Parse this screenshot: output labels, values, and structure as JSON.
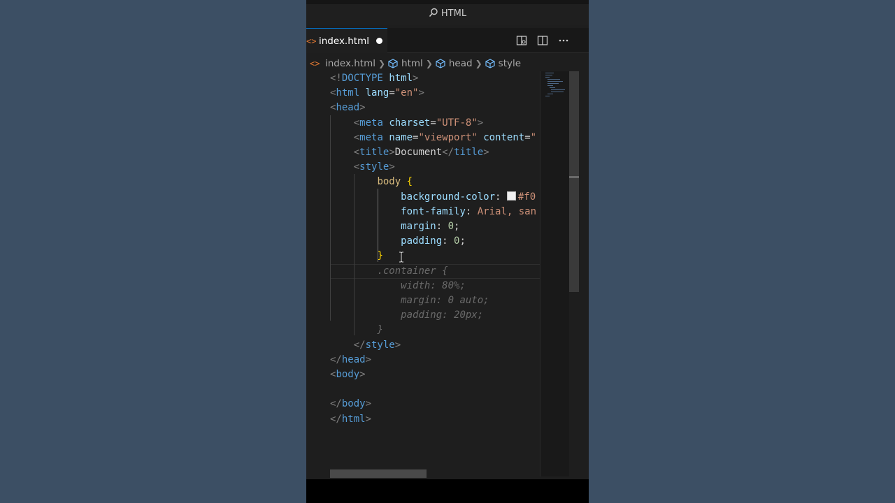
{
  "command_center": {
    "label": "HTML",
    "icon": "search-icon"
  },
  "tab": {
    "icon": "html-file-icon",
    "name": "index.html",
    "modified": true
  },
  "tab_actions": [
    "open-preview-icon",
    "split-editor-icon",
    "more-actions-icon"
  ],
  "breadcrumb": {
    "file": "index.html",
    "items": [
      "html",
      "head",
      "style"
    ]
  },
  "code_lines": [
    [
      {
        "t": "punc",
        "v": "<!"
      },
      {
        "t": "tag",
        "v": "DOCTYPE"
      },
      {
        "t": "text",
        "v": " "
      },
      {
        "t": "attr",
        "v": "html"
      },
      {
        "t": "punc",
        "v": ">"
      }
    ],
    [
      {
        "t": "punc",
        "v": "<"
      },
      {
        "t": "tag",
        "v": "html"
      },
      {
        "t": "text",
        "v": " "
      },
      {
        "t": "attr",
        "v": "lang"
      },
      {
        "t": "text",
        "v": "="
      },
      {
        "t": "str",
        "v": "\"en\""
      },
      {
        "t": "punc",
        "v": ">"
      }
    ],
    [
      {
        "t": "punc",
        "v": "<"
      },
      {
        "t": "tag",
        "v": "head"
      },
      {
        "t": "punc",
        "v": ">"
      }
    ],
    [
      {
        "t": "text",
        "v": "    "
      },
      {
        "t": "punc",
        "v": "<"
      },
      {
        "t": "tag",
        "v": "meta"
      },
      {
        "t": "text",
        "v": " "
      },
      {
        "t": "attr",
        "v": "charset"
      },
      {
        "t": "text",
        "v": "="
      },
      {
        "t": "str",
        "v": "\"UTF-8\""
      },
      {
        "t": "punc",
        "v": ">"
      }
    ],
    [
      {
        "t": "text",
        "v": "    "
      },
      {
        "t": "punc",
        "v": "<"
      },
      {
        "t": "tag",
        "v": "meta"
      },
      {
        "t": "text",
        "v": " "
      },
      {
        "t": "attr",
        "v": "name"
      },
      {
        "t": "text",
        "v": "="
      },
      {
        "t": "str",
        "v": "\"viewport\""
      },
      {
        "t": "text",
        "v": " "
      },
      {
        "t": "attr",
        "v": "content"
      },
      {
        "t": "text",
        "v": "="
      },
      {
        "t": "str",
        "v": "\""
      }
    ],
    [
      {
        "t": "text",
        "v": "    "
      },
      {
        "t": "punc",
        "v": "<"
      },
      {
        "t": "tag",
        "v": "title"
      },
      {
        "t": "punc",
        "v": ">"
      },
      {
        "t": "text",
        "v": "Document"
      },
      {
        "t": "punc",
        "v": "</"
      },
      {
        "t": "tag",
        "v": "title"
      },
      {
        "t": "punc",
        "v": ">"
      }
    ],
    [
      {
        "t": "text",
        "v": "    "
      },
      {
        "t": "punc",
        "v": "<"
      },
      {
        "t": "tag",
        "v": "style"
      },
      {
        "t": "punc",
        "v": ">"
      }
    ],
    [
      {
        "t": "text",
        "v": "        "
      },
      {
        "t": "sel",
        "v": "body"
      },
      {
        "t": "text",
        "v": " "
      },
      {
        "t": "brace",
        "v": "{"
      }
    ],
    [
      {
        "t": "text",
        "v": "            "
      },
      {
        "t": "prop",
        "v": "background-color"
      },
      {
        "t": "text",
        "v": ": "
      },
      {
        "t": "swatch",
        "v": ""
      },
      {
        "t": "str",
        "v": "#f0"
      }
    ],
    [
      {
        "t": "text",
        "v": "            "
      },
      {
        "t": "prop",
        "v": "font-family"
      },
      {
        "t": "text",
        "v": ": "
      },
      {
        "t": "str",
        "v": "Arial, san"
      }
    ],
    [
      {
        "t": "text",
        "v": "            "
      },
      {
        "t": "prop",
        "v": "margin"
      },
      {
        "t": "text",
        "v": ": "
      },
      {
        "t": "num",
        "v": "0"
      },
      {
        "t": "text",
        "v": ";"
      }
    ],
    [
      {
        "t": "text",
        "v": "            "
      },
      {
        "t": "prop",
        "v": "padding"
      },
      {
        "t": "text",
        "v": ": "
      },
      {
        "t": "num",
        "v": "0"
      },
      {
        "t": "text",
        "v": ";"
      }
    ],
    [
      {
        "t": "text",
        "v": "        "
      },
      {
        "t": "brace",
        "v": "}"
      }
    ],
    [
      {
        "t": "text",
        "v": "        "
      },
      {
        "t": "ghost",
        "v": ".container {"
      }
    ],
    [
      {
        "t": "text",
        "v": "            "
      },
      {
        "t": "ghost",
        "v": "width: 80%;"
      }
    ],
    [
      {
        "t": "text",
        "v": "            "
      },
      {
        "t": "ghost",
        "v": "margin: 0 auto;"
      }
    ],
    [
      {
        "t": "text",
        "v": "            "
      },
      {
        "t": "ghost",
        "v": "padding: 20px;"
      }
    ],
    [
      {
        "t": "text",
        "v": "        "
      },
      {
        "t": "ghost",
        "v": "}"
      }
    ],
    [
      {
        "t": "text",
        "v": "    "
      },
      {
        "t": "punc",
        "v": "</"
      },
      {
        "t": "tag",
        "v": "style"
      },
      {
        "t": "punc",
        "v": ">"
      }
    ],
    [
      {
        "t": "punc",
        "v": "</"
      },
      {
        "t": "tag",
        "v": "head"
      },
      {
        "t": "punc",
        "v": ">"
      }
    ],
    [
      {
        "t": "punc",
        "v": "<"
      },
      {
        "t": "tag",
        "v": "body"
      },
      {
        "t": "punc",
        "v": ">"
      }
    ],
    [],
    [
      {
        "t": "punc",
        "v": "</"
      },
      {
        "t": "tag",
        "v": "body"
      },
      {
        "t": "punc",
        "v": ">"
      }
    ],
    [
      {
        "t": "punc",
        "v": "</"
      },
      {
        "t": "tag",
        "v": "html"
      },
      {
        "t": "punc",
        "v": ">"
      }
    ]
  ],
  "colors": {
    "editor_bg": "#1e1e1e",
    "tag": "#569cd6",
    "attribute": "#9cdcfe",
    "string": "#ce9178",
    "selector": "#d7ba7d",
    "brace": "#ffd700",
    "number": "#b5cea8",
    "ghost_suggestion": "#6a6a6a",
    "active_tab_border": "#0078d4",
    "outer_background": "#3c4f64"
  }
}
